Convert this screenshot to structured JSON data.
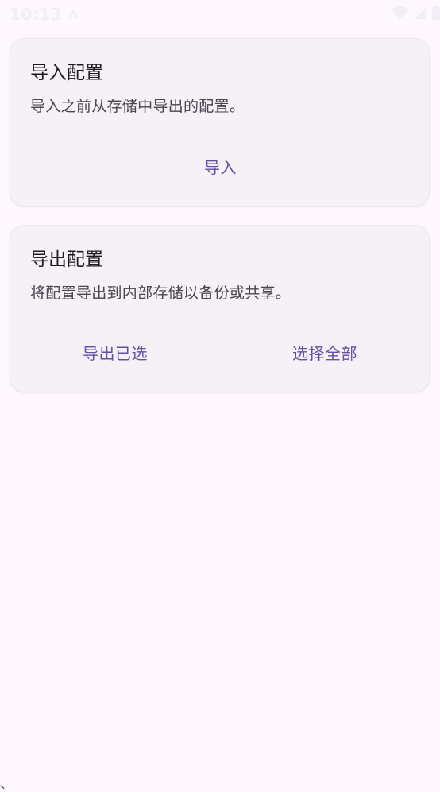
{
  "status_bar": {
    "time": "10:13",
    "notification_icon": "notification-icon",
    "wifi_icon": "wifi-icon",
    "signal_icon": "signal-icon",
    "battery_icon": "battery-icon"
  },
  "import_card": {
    "title": "导入配置",
    "description": "导入之前从存储中导出的配置。",
    "import_label": "导入"
  },
  "export_card": {
    "title": "导出配置",
    "description": "将配置导出到内部存储以备份或共享。",
    "export_selected_label": "导出已选",
    "select_all_label": "选择全部"
  },
  "colors": {
    "background": "#fef7fd",
    "card": "#f5f1f7",
    "accent": "#6750a4",
    "title_text": "#1d1b20",
    "body_text": "#49454f"
  }
}
